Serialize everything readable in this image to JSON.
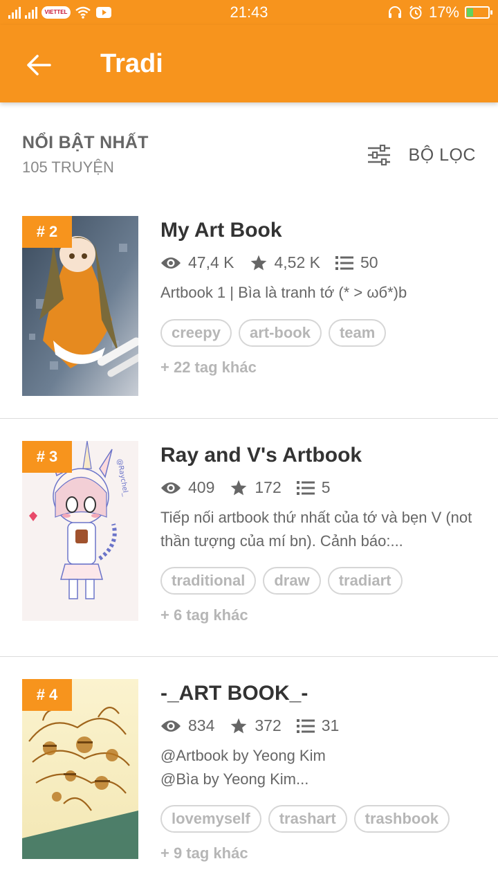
{
  "status_bar": {
    "carrier": "VIETTEL",
    "time": "21:43",
    "battery": "17%",
    "battery_level": 0.17,
    "icons": [
      "signal-icon",
      "wifi-icon",
      "youtube-icon",
      "headset-icon",
      "alarm-icon",
      "battery-icon"
    ]
  },
  "app_bar": {
    "title": "Tradi",
    "back_icon": "arrow-left-icon"
  },
  "header": {
    "title": "NỔI BẬT NHẤT",
    "count": "105 TRUYỆN",
    "filter_label": "BỘ LỌC",
    "filter_icon": "sliders-icon"
  },
  "stories": [
    {
      "rank": "# 2",
      "title": "My Art Book",
      "reads": "47,4 K",
      "votes": "4,52 K",
      "parts": "50",
      "description": "Artbook 1 | Bìa là tranh tớ (* > ωб*)b",
      "tags": [
        "creepy",
        "art-book",
        "team"
      ],
      "more_tags": "+ 22 tag khác"
    },
    {
      "rank": "# 3",
      "title": "Ray and V's Artbook",
      "reads": "409",
      "votes": "172",
      "parts": "5",
      "description": "Tiếp nối artbook thứ nhất của tớ và bẹn V (not thần tượng của mí bn). Cảnh báo:...",
      "tags": [
        "traditional",
        "draw",
        "tradiart"
      ],
      "more_tags": "+ 6 tag khác"
    },
    {
      "rank": "# 4",
      "title": "-_ART BOOK_-",
      "reads": "834",
      "votes": "372",
      "parts": "31",
      "description": "@Artbook by Yeong Kim\n@Bìa by Yeong Kim...",
      "tags": [
        "lovemyself",
        "trashart",
        "trashbook"
      ],
      "more_tags": "+ 9 tag khác"
    }
  ],
  "colors": {
    "accent": "#f7941d",
    "text_dark": "#333333",
    "text_muted": "#666666",
    "tag_border": "#d6d6d6",
    "tag_text": "#b6b6b6"
  }
}
